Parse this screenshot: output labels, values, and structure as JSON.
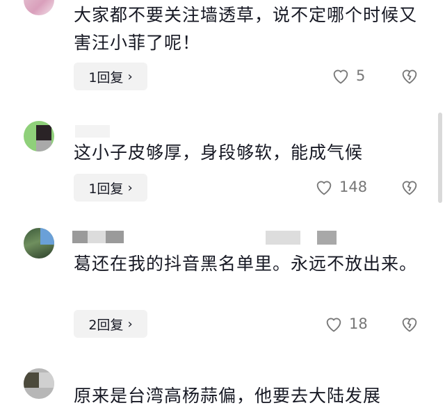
{
  "comments": [
    {
      "text": "大家都不要关注墙透草，说不定哪个时候又害汪小菲了呢！",
      "reply_label": "1回复",
      "likes": "5"
    },
    {
      "text": "这小子皮够厚，身段够软，能成气候",
      "reply_label": "1回复",
      "likes": "148"
    },
    {
      "text": "葛还在我的抖音黑名单里。永远不放出来。",
      "reply_label": "2回复",
      "likes": "18"
    },
    {
      "text": "原来是台湾高杨蒜偏，他要去大陆发展",
      "reply_label": "",
      "likes": ""
    }
  ],
  "icons": {
    "like": "heart-outline-icon",
    "dislike": "broken-heart-icon",
    "reply_chevron": "chevron-right-icon"
  }
}
